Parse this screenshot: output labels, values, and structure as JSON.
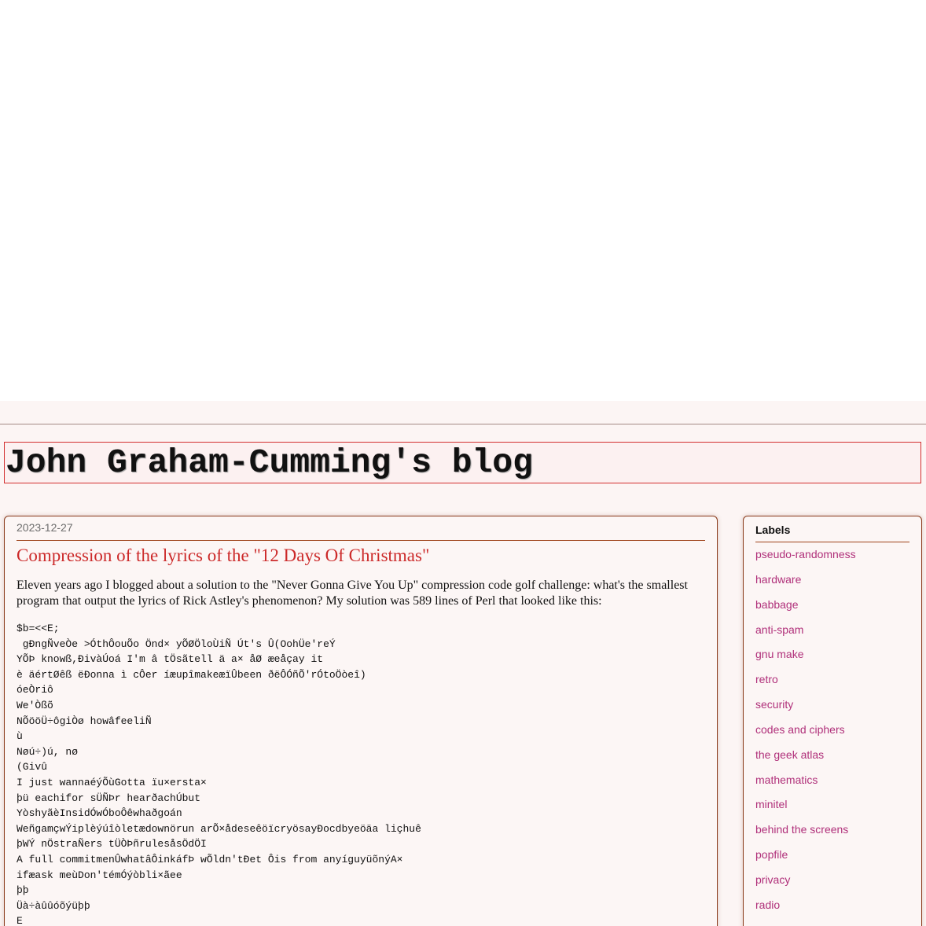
{
  "blog": {
    "title": "John Graham-Cumming's blog"
  },
  "post": {
    "date": "2023-12-27",
    "title": "Compression of the lyrics of the \"12 Days Of Christmas\"",
    "intro": "Eleven years ago I blogged about a solution to the \"Never Gonna Give You Up\" compression code golf challenge: what's the smallest program that output the lyrics of Rick Astley's phenomenon? My solution was 589 lines of Perl that looked like this:",
    "code_lines": [
      "$b=<<E;",
      " gÐngÑveÒe >ÓthÔouÕo Önd× yÕØÖloÙiÑ Út's Û(OohÜe'reÝ",
      "YÕÞ knowß,ÐivàÚoá I'm â tÖsãtell ä a× åØ æeåçay it",
      "è äértØêß ëÐonna ì cÔer íæupîmakeæïÛbeen ðëÔÓñÕ'rÓtoÖòeî)",
      "óeÒriô",
      "We'Òßõ",
      "NÕööÜ÷ôgiÒø howâfeeliÑ",
      "ù",
      "Nøú÷)ú, nø",
      "(Givû",
      "I just wannaéýÕùGotta ïu×ersta×",
      "þü eachifor sÜÑÞr hearðachÚbut",
      "YòshyãèInsidÓwÓboÔêwhaðgoán",
      "WeñgamçwÝiplèýúîòletædownörun arÕ×ådeseêöïcryösayÐocdbyeöäa liçhuê",
      "þWÝ nÖstraÑers tÜÒÞñrulesåsÖdÖI",
      "A full commitmenÛwhatâÔinkáfÞ wÕldn'tÐet Ôis from anyíguyüõnýA×",
      "ifæask meùDon'témÓýòbli×ãee",
      "þþ",
      "Üà÷àûûóõýüþþ",
      "E"
    ]
  },
  "sidebar": {
    "heading": "Labels",
    "labels": [
      "pseudo-randomness",
      "hardware",
      "babbage",
      "anti-spam",
      "gnu make",
      "retro",
      "security",
      "codes and ciphers",
      "the geek atlas",
      "mathematics",
      "minitel",
      "behind the screens",
      "popfile",
      "privacy",
      "radio"
    ]
  }
}
